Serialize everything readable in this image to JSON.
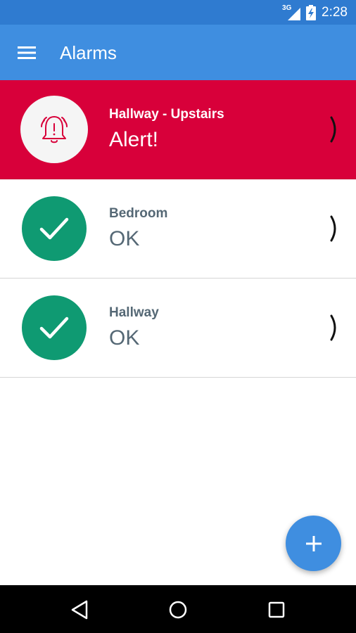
{
  "status_bar": {
    "network_label": "3G",
    "time": "2:28",
    "icons": [
      "signal-icon",
      "battery-charging-icon"
    ]
  },
  "app_bar": {
    "title": "Alarms",
    "menu_icon": "hamburger-menu-icon"
  },
  "alarms": [
    {
      "name": "Hallway - Upstairs",
      "status": "Alert!",
      "state": "alert",
      "icon": "alarm-bell-icon"
    },
    {
      "name": "Bedroom",
      "status": "OK",
      "state": "ok",
      "icon": "check-icon"
    },
    {
      "name": "Hallway",
      "status": "OK",
      "state": "ok",
      "icon": "check-icon"
    }
  ],
  "fab": {
    "icon": "plus-icon"
  },
  "nav_bar": {
    "icons": [
      "back-icon",
      "home-icon",
      "recents-icon"
    ]
  },
  "colors": {
    "status_bar": "#2f7bd0",
    "app_bar": "#3f8ee0",
    "alert_row": "#d8003a",
    "ok_circle": "#0f9a72",
    "text_secondary": "#556875",
    "fab": "#3f8ee0"
  }
}
